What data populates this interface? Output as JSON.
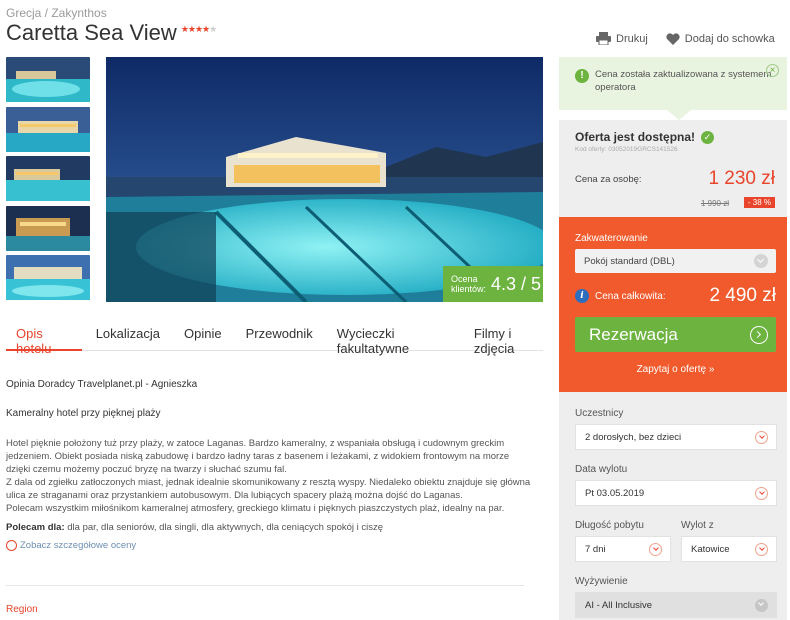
{
  "breadcrumb": "Grecja / Zakynthos",
  "hotel": {
    "name": "Caretta Sea View",
    "stars_full": "★★★★",
    "stars_empty": "★"
  },
  "actions": {
    "print": "Drukuj",
    "save": "Dodaj do schowka"
  },
  "rating": {
    "label": "Ocena klientów:",
    "value": "4.3",
    "max": "/ 5"
  },
  "tabs": [
    "Opis hotelu",
    "Lokalizacja",
    "Opinie",
    "Przewodnik",
    "Wycieczki fakultatywne",
    "Filmy i zdjęcia"
  ],
  "content": {
    "opinion_author": "Opinia Doradcy Travelplanet.pl - Agnieszka",
    "heading": "Kameralny hotel przy pięknej plaży",
    "paragraph": "Hotel pięknie położony tuż przy plaży, w zatoce Laganas. Bardzo kameralny, z wspaniała obsługą i cudownym greckim jedzeniem. Obiekt posiada niską zabudowę i bardzo ładny taras z basenem i leżakami, z widokiem frontowym na morze dzięki czemu możemy poczuć bryzę na twarzy i słuchać szumu fal.",
    "paragraph2": "Z dala od zgiełku zatłoczonych miast, jednak idealnie skomunikowany z resztą wyspy. Niedaleko obiektu znajduje się główna ulica ze straganami oraz przystankiem autobusowym. Dla lubiących spacery plażą można dojść do Laganas.",
    "paragraph3": "Polecam wszystkim miłośnikom kameralnej atmosfery, greckiego klimatu i pięknych piaszczystych plaż, idealny na par.",
    "recommend_label": "Polecam dla:",
    "recommend_text": " dla par, dla seniorów, dla singli, dla aktywnych, dla ceniących spokój i ciszę",
    "see_ratings": "Zobacz szczegółowe oceny",
    "region": "Region"
  },
  "sidebar": {
    "notice": "Cena została zaktualizowana z systemem operatora",
    "available": "Oferta jest dostępna!",
    "offer_code": "Kod oferty: 03052019GRCS141526",
    "price_label": "Cena za osobę:",
    "price": "1 230 zł",
    "old_price": "1 990 zł",
    "discount": "- 38 %",
    "accommodation_label": "Zakwaterowanie",
    "accommodation_value": "Pokój standard (DBL)",
    "total_label": "Cena całkowita:",
    "total_value": "2 490 zł",
    "reserve": "Rezerwacja",
    "ask": "Zapytaj o ofertę »",
    "participants_label": "Uczestnicy",
    "participants_value": "2 dorosłych, bez dzieci",
    "departure_label": "Data wylotu",
    "departure_value": "Pt 03.05.2019",
    "stay_label": "Długość pobytu",
    "stay_value": "7 dni",
    "from_label": "Wylot z",
    "from_value": "Katowice",
    "board_label": "Wyżywienie",
    "board_value": "AI - All Inclusive"
  },
  "colors": {
    "accent": "#e8452c",
    "orange_panel": "#f05a2c",
    "green": "#6db33f",
    "link": "#6d8fb3"
  }
}
